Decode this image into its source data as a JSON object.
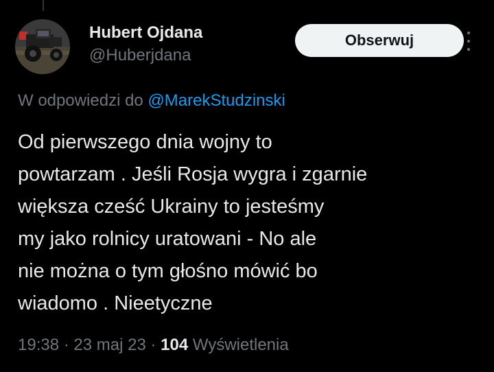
{
  "colors": {
    "background": "#000000",
    "primary_text": "#e7e9ea",
    "secondary_text": "#71767b",
    "link": "#1d9bf0",
    "button_bg": "#eff3f4",
    "button_text": "#0f1419"
  },
  "author": {
    "display_name": "Hubert Ojdana",
    "handle": "@Huberjdana",
    "avatar_icon": "tractor-photo-avatar"
  },
  "follow_button": {
    "label": "Obserwuj"
  },
  "more_icon": "more-vertical-icon",
  "reply": {
    "prefix": "W odpowiedzi do",
    "mention": "@MarekStudzinski"
  },
  "tweet": {
    "lines": [
      "Od pierwszego dnia wojny to",
      "powtarzam . Jeśli Rosja wygra i zgarnie",
      "większa cześć Ukrainy to jesteśmy",
      "my jako rolnicy uratowani - No ale",
      "nie można o tym głośno mówić bo",
      "wiadomo . Nieetyczne"
    ]
  },
  "meta": {
    "time": "19:38",
    "separator": "·",
    "date": "23 maj 23",
    "views_count": "104",
    "views_label": "Wyświetlenia"
  }
}
